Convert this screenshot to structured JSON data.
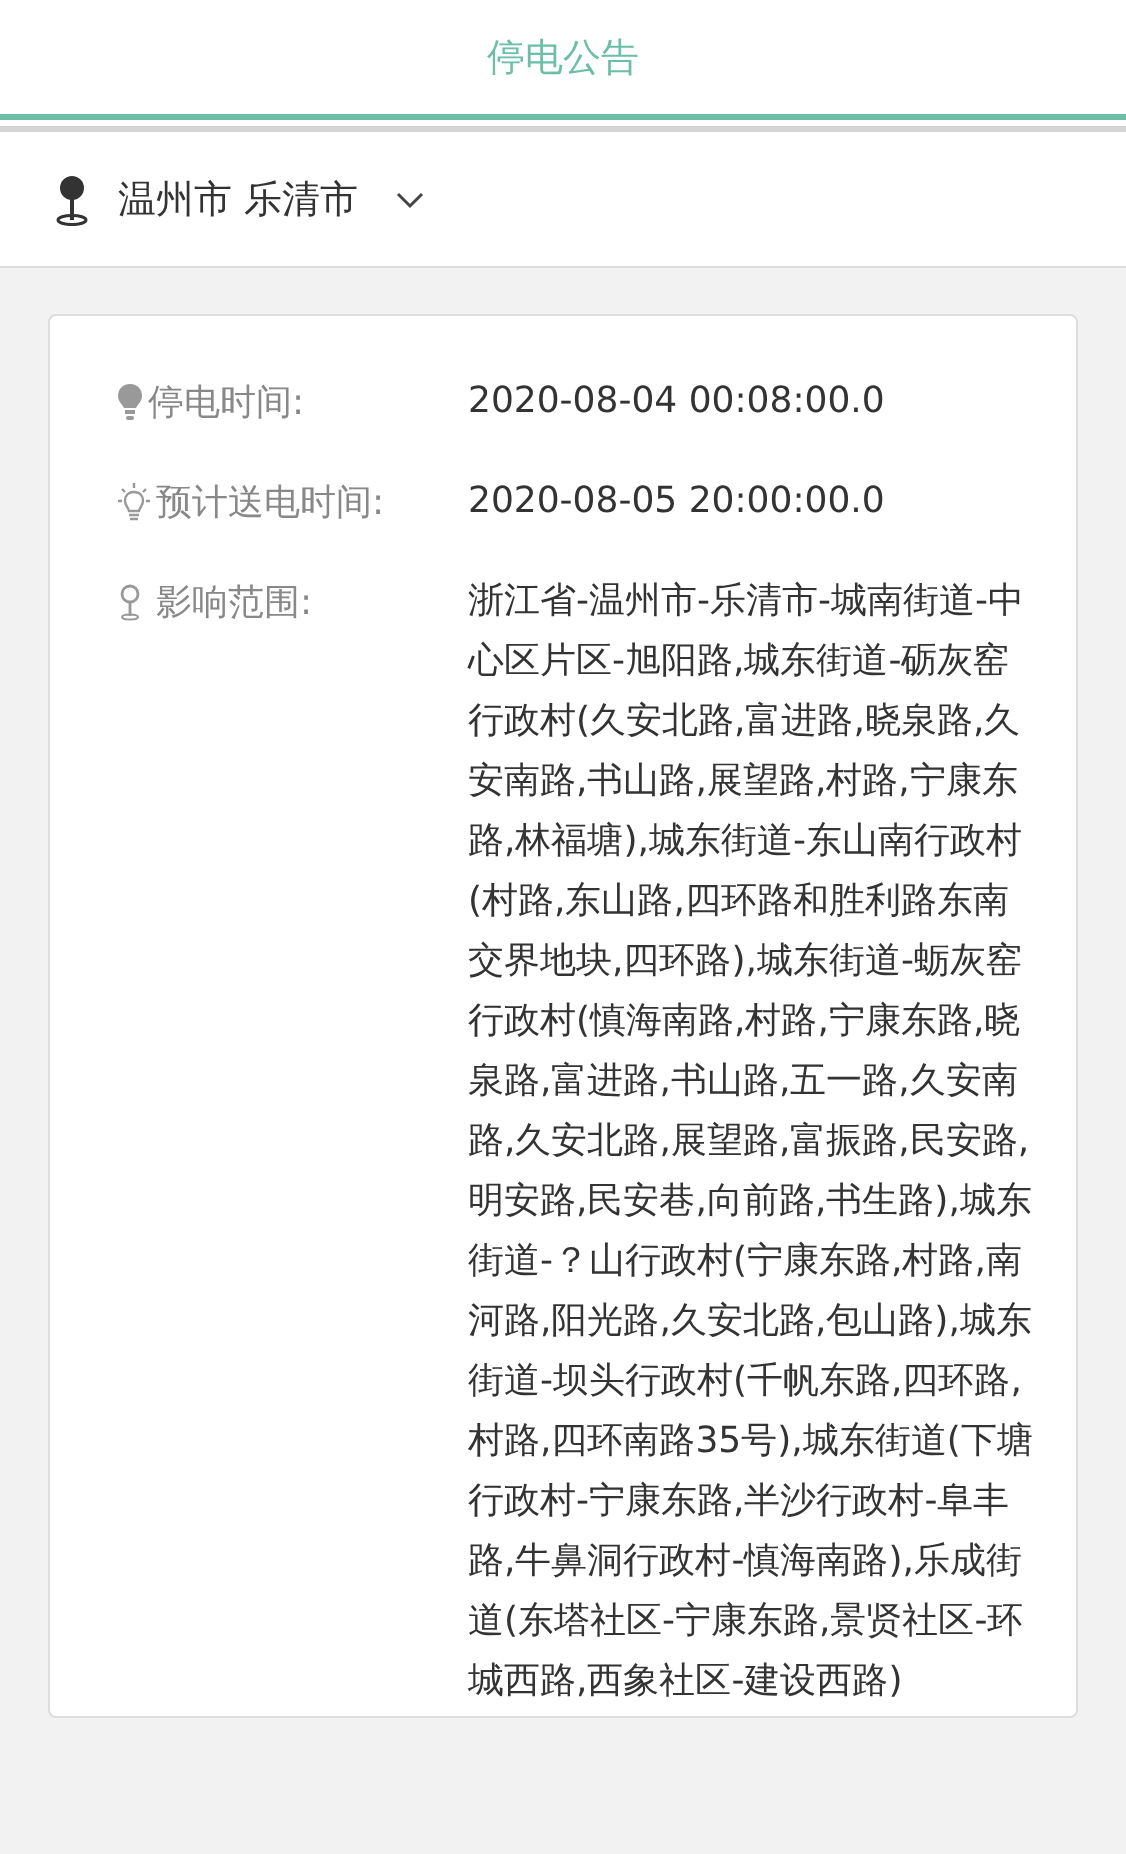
{
  "header": {
    "title": "停电公告"
  },
  "location": {
    "text": "温州市 乐清市",
    "expanded": false
  },
  "notice": {
    "rows": [
      {
        "kind": "bulb",
        "label": "停电时间:",
        "value": "2020-08-04 00:08:00.0"
      },
      {
        "kind": "bulb-outline",
        "label": "预计送电时间:",
        "value": "2020-08-05 20:00:00.0"
      },
      {
        "kind": "pin",
        "label": "影响范围:",
        "value": "浙江省-温州市-乐清市-城南街道-中心区片区-旭阳路,城东街道-砺灰窑行政村(久安北路,富进路,晓泉路,久安南路,书山路,展望路,村路,宁康东路,林福塘),城东街道-东山南行政村(村路,东山路,四环路和胜利路东南交界地块,四环路),城东街道-蛎灰窑行政村(慎海南路,村路,宁康东路,晓泉路,富进路,书山路,五一路,久安南路,久安北路,展望路,富振路,民安路,明安路,民安巷,向前路,书生路),城东街道-？山行政村(宁康东路,村路,南河路,阳光路,久安北路,包山路),城东街道-坝头行政村(千帆东路,四环路,村路,四环南路35号),城东街道(下塘行政村-宁康东路,半沙行政村-阜丰路,牛鼻洞行政村-慎海南路),乐成街道(东塔社区-宁康东路,景贤社区-环城西路,西象社区-建设西路)"
      }
    ]
  }
}
